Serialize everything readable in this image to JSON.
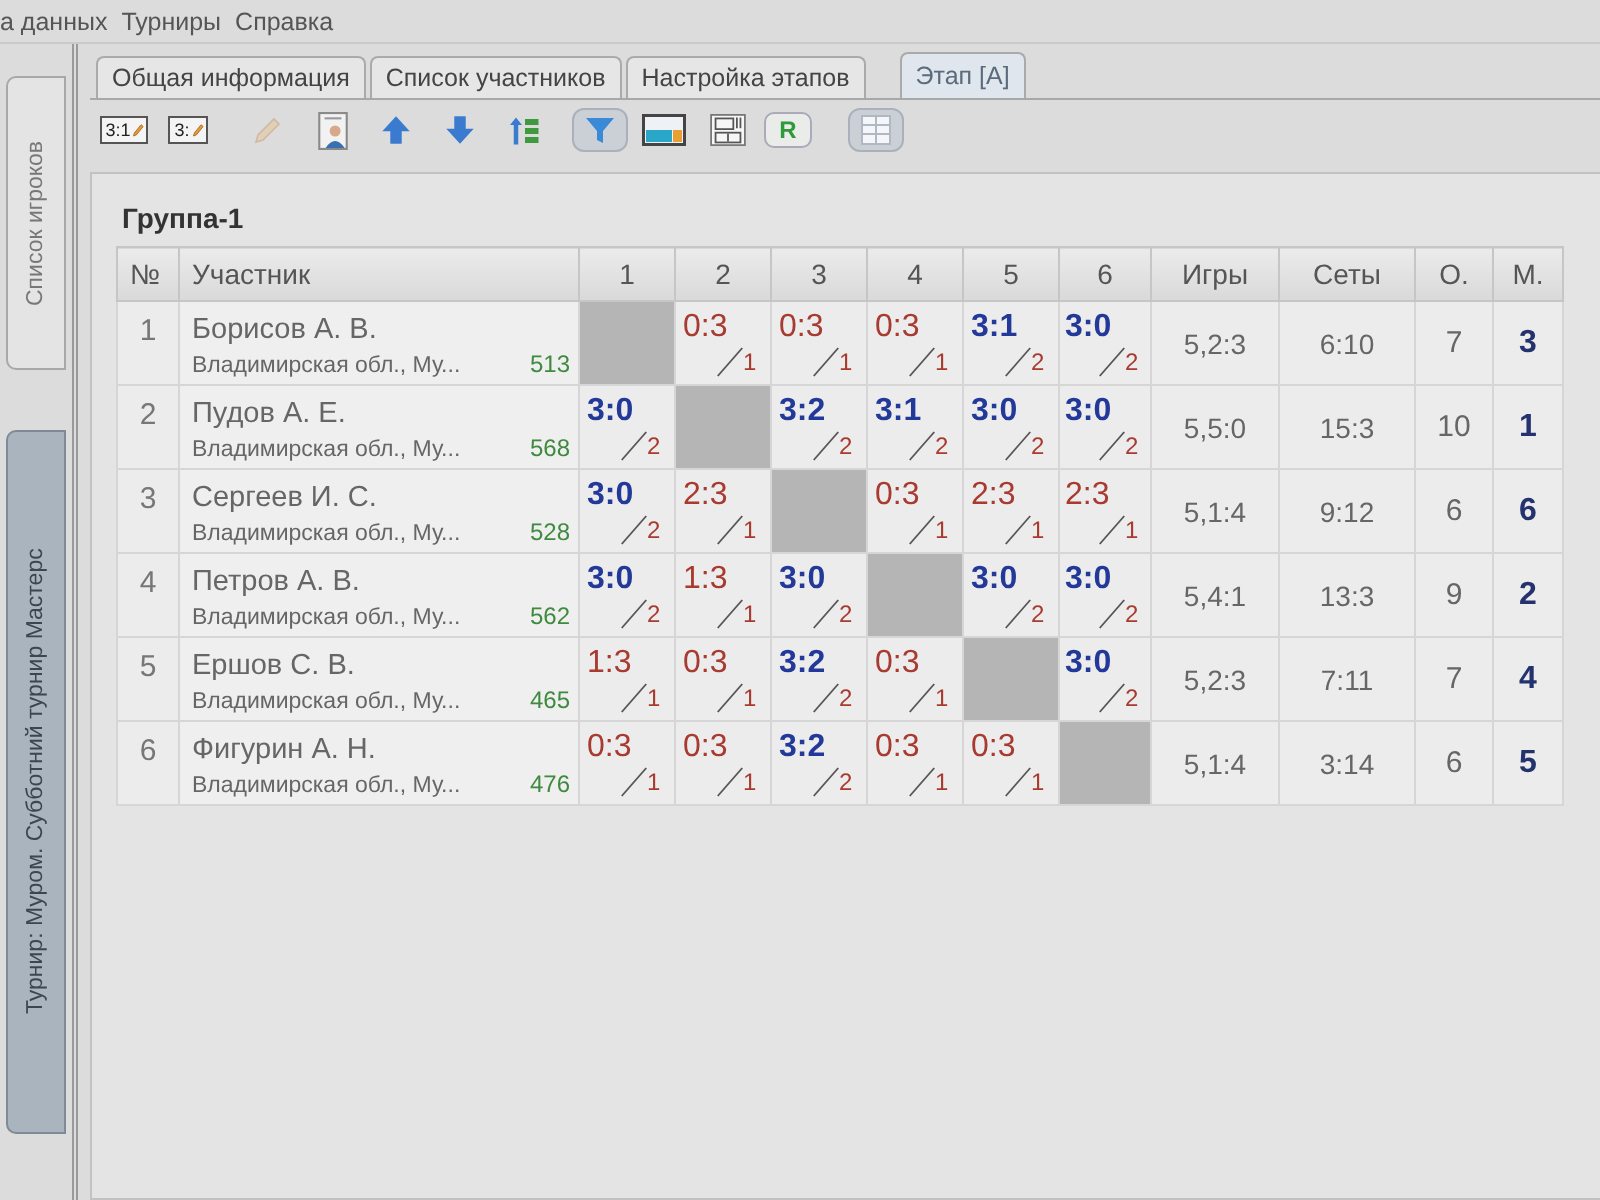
{
  "menu": [
    {
      "label": "а данных"
    },
    {
      "label": "Турниры"
    },
    {
      "label": "Справка"
    }
  ],
  "side_tabs": [
    {
      "label": "Список игроков",
      "selected": false
    },
    {
      "label": "Турнир: Муром. Субботний турнир Мастерс",
      "selected": true
    }
  ],
  "tabs": [
    {
      "label": "Общая информация",
      "selected": false
    },
    {
      "label": "Список участников",
      "selected": false
    },
    {
      "label": "Настройка этапов",
      "selected": false
    },
    {
      "label": "Этап [A]",
      "selected": true
    }
  ],
  "toolbar": [
    {
      "kind": "score",
      "label": "3:1",
      "pressed": false,
      "disabled": false
    },
    {
      "kind": "score",
      "label": "3:",
      "pressed": false,
      "disabled": false
    },
    {
      "kind": "pencil",
      "pressed": false,
      "disabled": true
    },
    {
      "kind": "person",
      "pressed": false,
      "disabled": false
    },
    {
      "kind": "up",
      "pressed": false,
      "disabled": false
    },
    {
      "kind": "down",
      "pressed": false,
      "disabled": false
    },
    {
      "kind": "sort",
      "pressed": false,
      "disabled": false
    },
    {
      "kind": "filter",
      "pressed": true,
      "disabled": false
    },
    {
      "kind": "layout",
      "pressed": false,
      "disabled": false
    },
    {
      "kind": "schedule",
      "pressed": false,
      "disabled": false
    },
    {
      "kind": "report",
      "label": "R",
      "pressed": false,
      "disabled": false
    },
    {
      "kind": "grid",
      "pressed": true,
      "disabled": false
    }
  ],
  "group": {
    "title": "Группа-1",
    "columns": [
      "№",
      "Участник",
      "1",
      "2",
      "3",
      "4",
      "5",
      "6",
      "Игры",
      "Сеты",
      "О.",
      "М."
    ],
    "rows": [
      {
        "number": "1",
        "name": "Борисов А. В.",
        "region": "Владимирская обл., Му...",
        "rating": "513",
        "results": [
          {
            "kind": "self"
          },
          {
            "kind": "match",
            "score": "0:3",
            "points": "1",
            "won": false
          },
          {
            "kind": "match",
            "score": "0:3",
            "points": "1",
            "won": false
          },
          {
            "kind": "match",
            "score": "0:3",
            "points": "1",
            "won": false
          },
          {
            "kind": "match",
            "score": "3:1",
            "points": "2",
            "won": true
          },
          {
            "kind": "match",
            "score": "3:0",
            "points": "2",
            "won": true
          }
        ],
        "games": "5,2:3",
        "sets": "6:10",
        "total_points": "7",
        "place": "3"
      },
      {
        "number": "2",
        "name": "Пудов А. Е.",
        "region": "Владимирская обл., Му...",
        "rating": "568",
        "results": [
          {
            "kind": "match",
            "score": "3:0",
            "points": "2",
            "won": true
          },
          {
            "kind": "self"
          },
          {
            "kind": "match",
            "score": "3:2",
            "points": "2",
            "won": true
          },
          {
            "kind": "match",
            "score": "3:1",
            "points": "2",
            "won": true
          },
          {
            "kind": "match",
            "score": "3:0",
            "points": "2",
            "won": true
          },
          {
            "kind": "match",
            "score": "3:0",
            "points": "2",
            "won": true
          }
        ],
        "games": "5,5:0",
        "sets": "15:3",
        "total_points": "10",
        "place": "1"
      },
      {
        "number": "3",
        "name": "Сергеев И. С.",
        "region": "Владимирская обл., Му...",
        "rating": "528",
        "results": [
          {
            "kind": "match",
            "score": "3:0",
            "points": "2",
            "won": true
          },
          {
            "kind": "match",
            "score": "2:3",
            "points": "1",
            "won": false
          },
          {
            "kind": "self"
          },
          {
            "kind": "match",
            "score": "0:3",
            "points": "1",
            "won": false
          },
          {
            "kind": "match",
            "score": "2:3",
            "points": "1",
            "won": false
          },
          {
            "kind": "match",
            "score": "2:3",
            "points": "1",
            "won": false
          }
        ],
        "games": "5,1:4",
        "sets": "9:12",
        "total_points": "6",
        "place": "6"
      },
      {
        "number": "4",
        "name": "Петров А. В.",
        "region": "Владимирская обл., Му...",
        "rating": "562",
        "results": [
          {
            "kind": "match",
            "score": "3:0",
            "points": "2",
            "won": true
          },
          {
            "kind": "match",
            "score": "1:3",
            "points": "1",
            "won": false
          },
          {
            "kind": "match",
            "score": "3:0",
            "points": "2",
            "won": true
          },
          {
            "kind": "self"
          },
          {
            "kind": "match",
            "score": "3:0",
            "points": "2",
            "won": true
          },
          {
            "kind": "match",
            "score": "3:0",
            "points": "2",
            "won": true
          }
        ],
        "games": "5,4:1",
        "sets": "13:3",
        "total_points": "9",
        "place": "2"
      },
      {
        "number": "5",
        "name": "Ершов С. В.",
        "region": "Владимирская обл., Му...",
        "rating": "465",
        "results": [
          {
            "kind": "match",
            "score": "1:3",
            "points": "1",
            "won": false
          },
          {
            "kind": "match",
            "score": "0:3",
            "points": "1",
            "won": false
          },
          {
            "kind": "match",
            "score": "3:2",
            "points": "2",
            "won": true
          },
          {
            "kind": "match",
            "score": "0:3",
            "points": "1",
            "won": false
          },
          {
            "kind": "self"
          },
          {
            "kind": "match",
            "score": "3:0",
            "points": "2",
            "won": true
          }
        ],
        "games": "5,2:3",
        "sets": "7:11",
        "total_points": "7",
        "place": "4"
      },
      {
        "number": "6",
        "name": "Фигурин А. Н.",
        "region": "Владимирская обл., Му...",
        "rating": "476",
        "results": [
          {
            "kind": "match",
            "score": "0:3",
            "points": "1",
            "won": false
          },
          {
            "kind": "match",
            "score": "0:3",
            "points": "1",
            "won": false
          },
          {
            "kind": "match",
            "score": "3:2",
            "points": "2",
            "won": true
          },
          {
            "kind": "match",
            "score": "0:3",
            "points": "1",
            "won": false
          },
          {
            "kind": "match",
            "score": "0:3",
            "points": "1",
            "won": false
          },
          {
            "kind": "self"
          }
        ],
        "games": "5,1:4",
        "sets": "3:14",
        "total_points": "6",
        "place": "5"
      }
    ]
  }
}
